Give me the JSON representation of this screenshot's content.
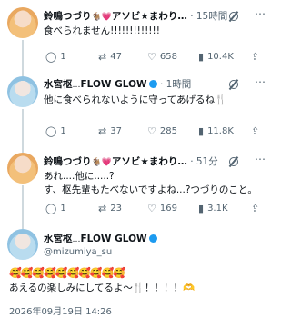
{
  "tweets": [
    {
      "name": "鈴鳴つづり",
      "emoji": "🐐💗",
      "tag": "アソビ★まわり…",
      "time": "· 15時間",
      "text": "食べられません!!!!!!!!!!!!!",
      "reply": "1",
      "retweet": "47",
      "like": "658",
      "views": "10.4K"
    },
    {
      "name": "水宮枢",
      "emoji": "…",
      "tag": "FLOW GLOW",
      "time": "· 1時間",
      "text": "他に食べられないように守ってあげるね🍴",
      "reply": "1",
      "retweet": "37",
      "like": "285",
      "views": "11.8K"
    },
    {
      "name": "鈴鳴つづり",
      "emoji": "🐐💗",
      "tag": "アソビ★まわり…",
      "time": "· 51分",
      "text_lines": [
        "あれ....他に.....?",
        "す、枢先輩もたべないですよね...?つづりのこと。"
      ],
      "reply": "1",
      "retweet": "23",
      "like": "169",
      "views": "3.1K"
    }
  ],
  "main_post": {
    "name": "水宮枢",
    "emoji": "…",
    "tag": "FLOW GLOW",
    "handle": "@mizumiya_su",
    "emoji_row": "🥰🥰🥰🥰🥰🥰🥰🥰🥰🥰",
    "text": "あえるの楽しみにしてるよ〜🍴！！！！🫶",
    "date": "2026年09月19日 14:26"
  },
  "icons": {
    "more": "more-icon",
    "grok": "grok-icon",
    "reply": "reply-icon",
    "retweet": "retweet-icon",
    "like": "like-icon",
    "views": "views-icon",
    "share": "share-icon"
  }
}
